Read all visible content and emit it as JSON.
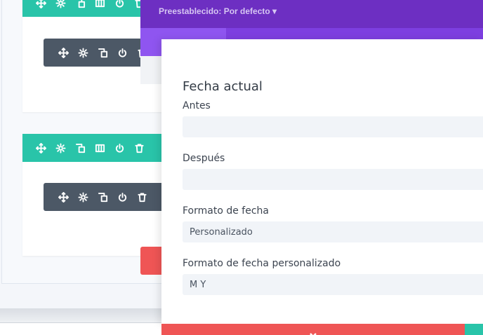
{
  "modal": {
    "preset_label": "Preestablecido: Por defecto ▾"
  },
  "section": {
    "title": "Fecha actual"
  },
  "fields": {
    "before_label": "Antes",
    "before_value": "",
    "after_label": "Después",
    "after_value": "",
    "date_format_label": "Formato de fecha",
    "date_format_value": "Personalizado",
    "custom_format_label": "Formato de fecha personalizado",
    "custom_format_value": "M Y"
  },
  "icons": {
    "row_toolbar": [
      "move-icon",
      "gear-icon",
      "duplicate-icon",
      "columns-icon",
      "power-icon",
      "trash-icon"
    ],
    "module_toolbar": [
      "move-icon",
      "gear-icon",
      "duplicate-icon",
      "power-icon",
      "trash-icon"
    ],
    "footer": "close-icon"
  },
  "colors": {
    "row_bar": "#29c4a9",
    "module_bar": "#4c5866",
    "modal_header": "#6d2fc2",
    "modal_tabs": "#7d3fe0",
    "cancel": "#ef5555",
    "save": "#29c4a9"
  }
}
